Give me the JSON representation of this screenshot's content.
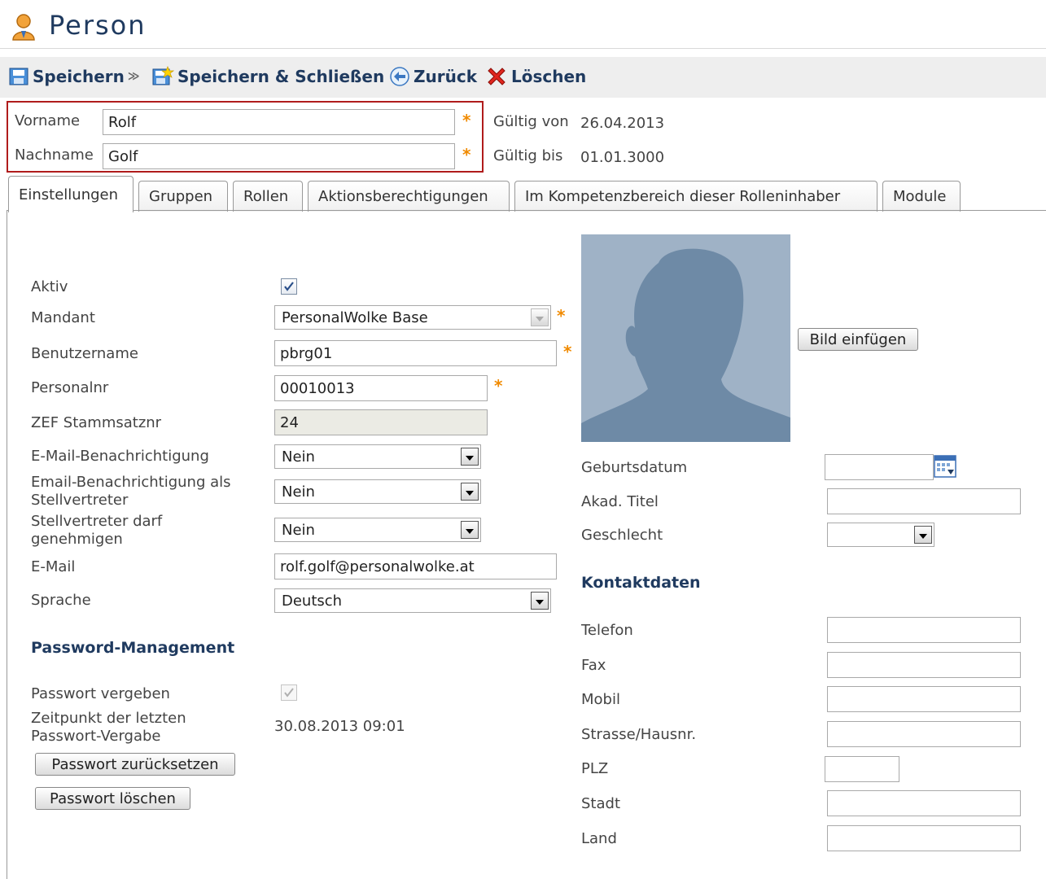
{
  "page": {
    "title": "Person"
  },
  "toolbar": {
    "save": "Speichern",
    "save_close": "Speichern & Schließen",
    "back": "Zurück",
    "delete": "Löschen"
  },
  "header": {
    "firstname_label": "Vorname",
    "firstname_value": "Rolf",
    "lastname_label": "Nachname",
    "lastname_value": "Golf",
    "valid_from_label": "Gültig von",
    "valid_from_value": "26.04.2013",
    "valid_to_label": "Gültig bis",
    "valid_to_value": "01.01.3000",
    "required_mark": "*"
  },
  "tabs": [
    {
      "label": "Einstellungen",
      "active": true
    },
    {
      "label": "Gruppen"
    },
    {
      "label": "Rollen"
    },
    {
      "label": "Aktionsberechtigungen"
    },
    {
      "label": "Im Kompetenzbereich dieser Rolleninhaber"
    },
    {
      "label": "Module"
    }
  ],
  "settings": {
    "active_label": "Aktiv",
    "active_checked": true,
    "client_label": "Mandant",
    "client_value": "PersonalWolke Base",
    "username_label": "Benutzername",
    "username_value": "pbrg01",
    "personnel_no_label": "Personalnr",
    "personnel_no_value": "00010013",
    "zef_label": "ZEF Stammsatznr",
    "zef_value": "24",
    "email_notify_label": "E-Mail-Benachrichtigung",
    "email_notify_value": "Nein",
    "email_notify_deputy_label_1": "Email-Benachrichtigung als",
    "email_notify_deputy_label_2": "Stellvertreter",
    "email_notify_deputy_value": "Nein",
    "deputy_approve_label_1": "Stellvertreter darf",
    "deputy_approve_label_2": "genehmigen",
    "deputy_approve_value": "Nein",
    "email_label": "E-Mail",
    "email_value": "rolf.golf@personalwolke.at",
    "language_label": "Sprache",
    "language_value": "Deutsch"
  },
  "password": {
    "section_title": "Password-Management",
    "assigned_label": "Passwort vergeben",
    "assigned_checked": true,
    "last_assigned_label_1": "Zeitpunkt der letzten",
    "last_assigned_label_2": "Passwort-Vergabe",
    "last_assigned_value": "30.08.2013 09:01",
    "reset_button": "Passwort zurücksetzen",
    "delete_button": "Passwort löschen"
  },
  "profile": {
    "insert_image_button": "Bild einfügen",
    "birthdate_label": "Geburtsdatum",
    "birthdate_value": "",
    "title_label": "Akad. Titel",
    "title_value": "",
    "gender_label": "Geschlecht",
    "gender_value": ""
  },
  "contact": {
    "section_title": "Kontaktdaten",
    "phone_label": "Telefon",
    "fax_label": "Fax",
    "mobile_label": "Mobil",
    "street_label": "Strasse/Hausnr.",
    "zip_label": "PLZ",
    "city_label": "Stadt",
    "country_label": "Land"
  }
}
